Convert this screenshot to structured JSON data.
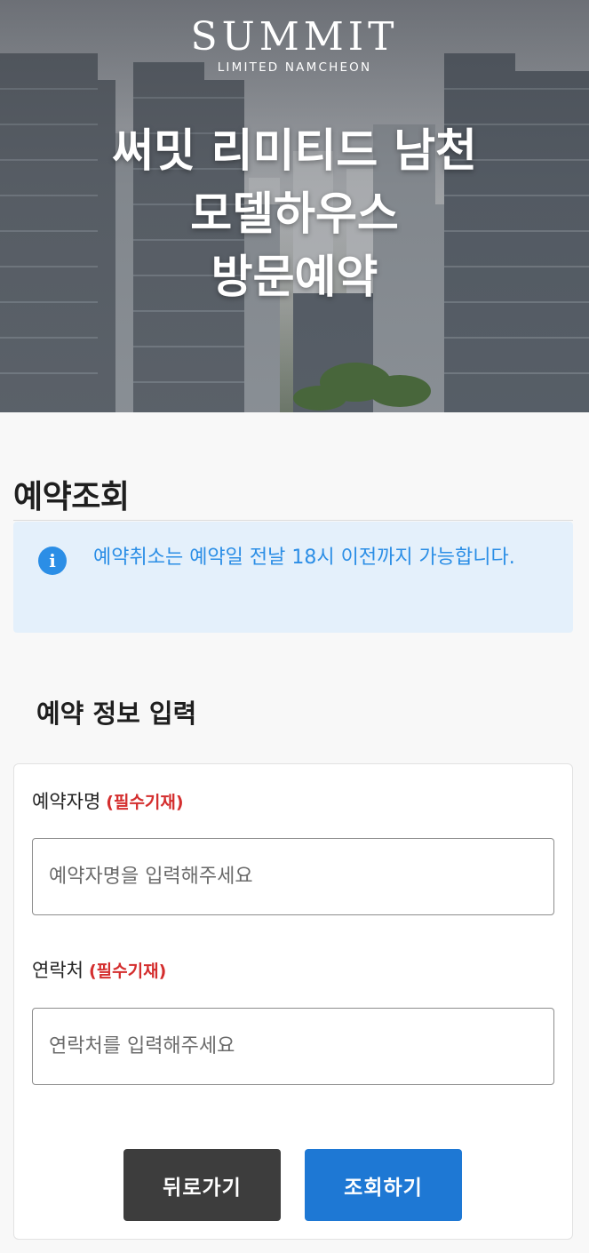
{
  "hero": {
    "brand_name": "SUMMIT",
    "brand_sub": "LIMITED NAMCHEON",
    "title_lines": [
      "써밋 리미티드 남천",
      "모델하우스",
      "방문예약"
    ]
  },
  "page": {
    "title": "예약조회"
  },
  "notice": {
    "icon": "info-icon",
    "text": "예약취소는 예약일 전날 18시 이전까지 가능합니다."
  },
  "form": {
    "section_title": "예약 정보 입력",
    "name_field": {
      "label": "예약자명",
      "required_tag": "(필수기재)",
      "placeholder": "예약자명을 입력해주세요",
      "value": ""
    },
    "phone_field": {
      "label": "연락처",
      "required_tag": "(필수기재)",
      "placeholder": "연락처를 입력해주세요",
      "value": ""
    },
    "back_button": "뒤로가기",
    "search_button": "조회하기"
  },
  "colors": {
    "accent": "#1e78d4",
    "notice_bg": "#e4f0fb",
    "notice_text": "#2b8ee6",
    "required": "#d42e2e",
    "back_button": "#3d3d3d"
  }
}
